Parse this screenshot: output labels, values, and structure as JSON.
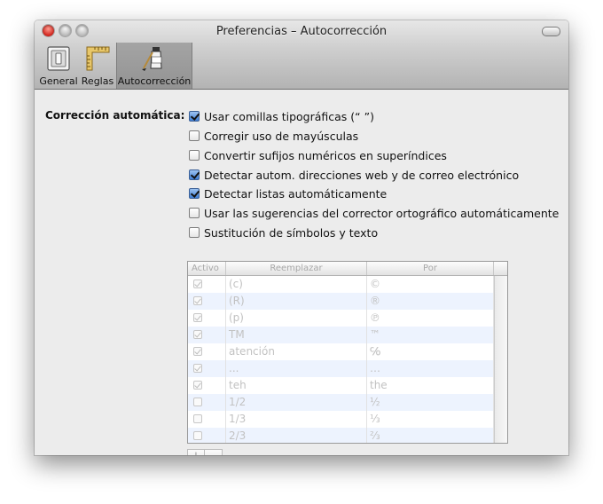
{
  "window": {
    "title": "Preferencias – Autocorrección"
  },
  "toolbar": {
    "items": [
      {
        "label": "General",
        "icon": "switch-icon"
      },
      {
        "label": "Reglas",
        "icon": "ruler-icon"
      },
      {
        "label": "Autocorrección",
        "icon": "spellcheck-icon",
        "selected": true
      }
    ]
  },
  "section": {
    "label": "Corrección automática:"
  },
  "options": [
    {
      "label": "Usar comillas tipográficas (“ ”)",
      "checked": true
    },
    {
      "label": "Corregir uso de mayúsculas",
      "checked": false
    },
    {
      "label": "Convertir sufijos numéricos en superíndices",
      "checked": false
    },
    {
      "label": "Detectar autom. direcciones web y de correo electrónico",
      "checked": true
    },
    {
      "label": "Detectar listas automáticamente",
      "checked": true
    },
    {
      "label": "Usar las sugerencias del corrector ortográfico automáticamente",
      "checked": false
    },
    {
      "label": "Sustitución de símbolos y texto",
      "checked": false
    }
  ],
  "table": {
    "headers": [
      "Activo",
      "Reemplazar",
      "Por"
    ],
    "rows": [
      {
        "active": true,
        "replace": "(c)",
        "with": "©"
      },
      {
        "active": true,
        "replace": "(R)",
        "with": "®"
      },
      {
        "active": true,
        "replace": "(p)",
        "with": "℗"
      },
      {
        "active": true,
        "replace": "TM",
        "with": "™"
      },
      {
        "active": true,
        "replace": "atención",
        "with": "℅"
      },
      {
        "active": true,
        "replace": "...",
        "with": "…"
      },
      {
        "active": true,
        "replace": "teh",
        "with": "the"
      },
      {
        "active": false,
        "replace": "1/2",
        "with": "½"
      },
      {
        "active": false,
        "replace": "1/3",
        "with": "⅓"
      },
      {
        "active": false,
        "replace": "2/3",
        "with": "⅔"
      }
    ]
  },
  "buttons": {
    "add": "+",
    "remove": "−"
  }
}
